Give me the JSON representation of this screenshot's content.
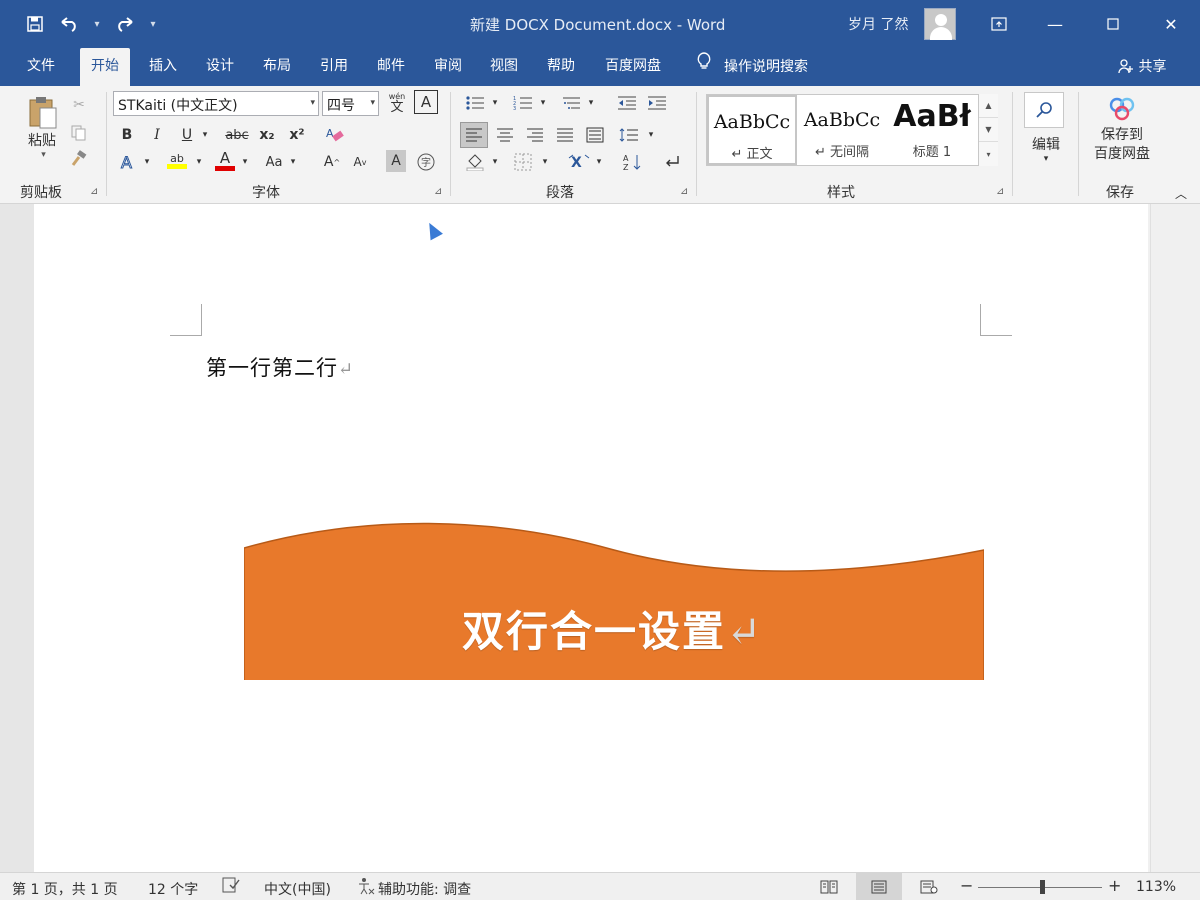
{
  "title_bar": {
    "document_title": "新建 DOCX Document.docx  -  Word",
    "user_name": "岁月 了然",
    "qat": {
      "save_icon": "save-icon",
      "undo_icon": "undo-icon",
      "redo_icon": "redo-icon",
      "customize_icon": "customize-icon"
    }
  },
  "tabs": [
    {
      "label": "文件"
    },
    {
      "label": "开始"
    },
    {
      "label": "插入"
    },
    {
      "label": "设计"
    },
    {
      "label": "布局"
    },
    {
      "label": "引用"
    },
    {
      "label": "邮件"
    },
    {
      "label": "审阅"
    },
    {
      "label": "视图"
    },
    {
      "label": "帮助"
    },
    {
      "label": "百度网盘"
    }
  ],
  "tell_me": "操作说明搜索",
  "share": "共享",
  "ribbon": {
    "clipboard": {
      "label": "剪贴板",
      "paste": "粘贴"
    },
    "font": {
      "label": "字体",
      "font_name": "STKaiti (中文正文)",
      "font_size": "四号",
      "bold": "B",
      "italic": "I",
      "underline": "U",
      "strike": "abc",
      "subscript": "x₂",
      "superscript": "x²",
      "font_color": "A",
      "change_case": "Aa",
      "grow": "A",
      "shrink": "A",
      "char_shading": "A",
      "pinyin": "wén",
      "border": "A"
    },
    "paragraph": {
      "label": "段落"
    },
    "styles": {
      "label": "样式",
      "items": [
        {
          "preview": "AaBbCc",
          "name": "↵ 正文"
        },
        {
          "preview": "AaBbCc",
          "name": "↵ 无间隔"
        },
        {
          "preview": "AaBł",
          "name": "标题 1"
        }
      ]
    },
    "editing": {
      "label": "编辑"
    },
    "save": {
      "label": "保存",
      "button": "保存到\n百度网盘",
      "line1": "保存到",
      "line2": "百度网盘"
    }
  },
  "document": {
    "line1": "第一行第二行",
    "paragraph_mark": "↵"
  },
  "banner": {
    "text": "双行合一设置",
    "paragraph_mark": "↵",
    "color": "#e8792b"
  },
  "status": {
    "page": "第 1 页，共 1 页",
    "words": "12 个字",
    "language": "中文(中国)",
    "accessibility": "辅助功能: 调查",
    "zoom": "113%",
    "zoom_minus": "−",
    "zoom_plus": "+"
  }
}
